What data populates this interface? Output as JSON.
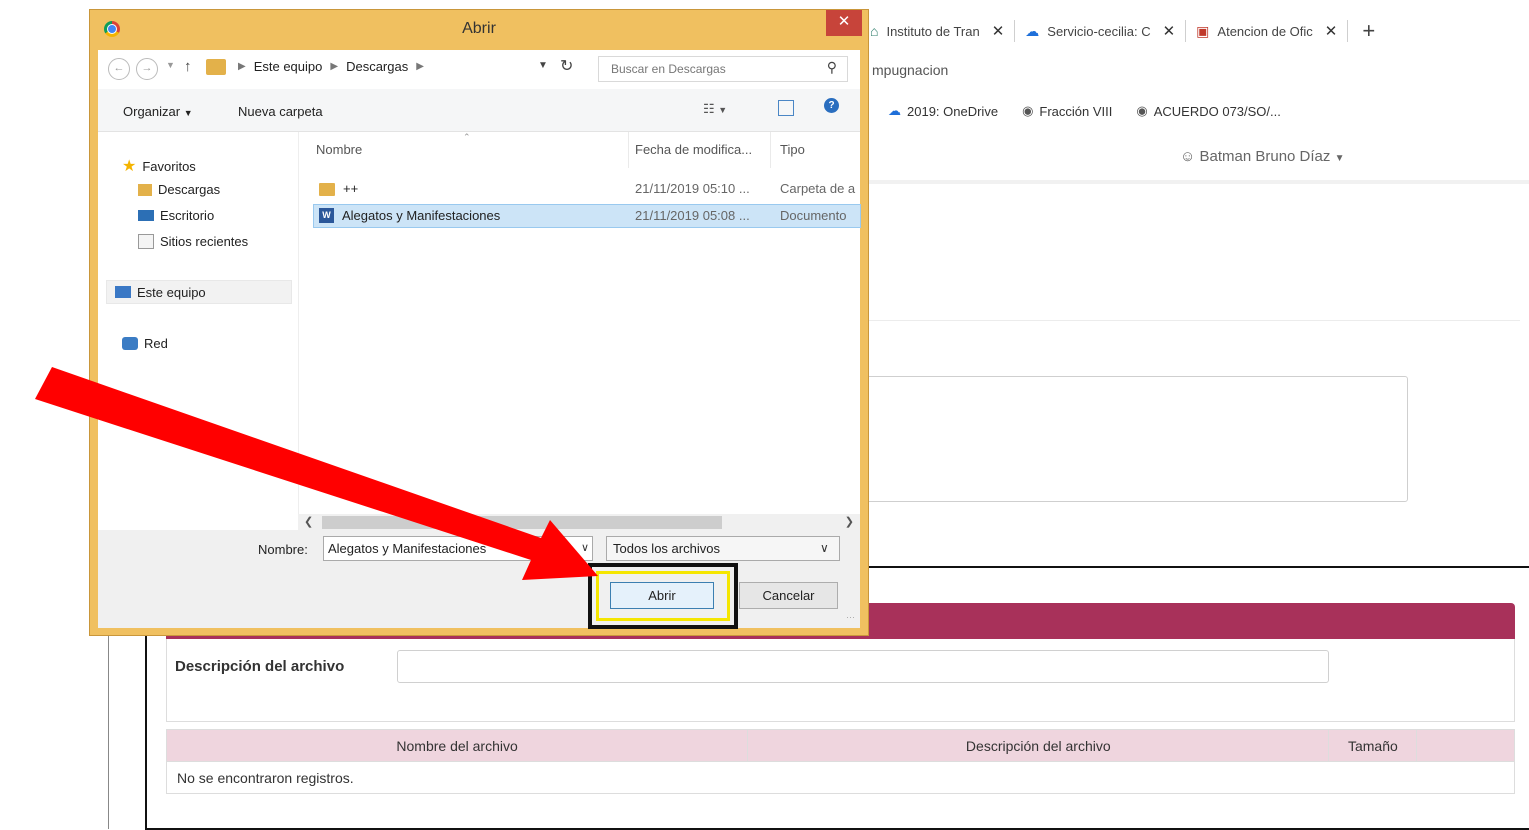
{
  "browser": {
    "tabs": [
      {
        "title": "Instituto de Tran",
        "icon": "house-icon"
      },
      {
        "title": "Servicio-cecilia: C",
        "icon": "cloud-icon"
      },
      {
        "title": "Atencion de Ofic",
        "icon": "app-icon"
      }
    ],
    "address_text": "mpugnacion",
    "bookmarks": [
      "2019: OneDrive",
      "Fracción VIII",
      "ACUERDO 073/SO/..."
    ],
    "user": "Batman Bruno Díaz"
  },
  "page": {
    "description_label": "Descripción del archivo",
    "table": {
      "columns": [
        "Nombre del archivo",
        "Descripción del archivo",
        "Tamaño"
      ],
      "empty_message": "No se encontraron registros."
    }
  },
  "dialog": {
    "title": "Abrir",
    "breadcrumb": [
      "Este equipo",
      "Descargas"
    ],
    "search_placeholder": "Buscar en Descargas",
    "toolbar": {
      "organize": "Organizar",
      "new_folder": "Nueva carpeta"
    },
    "nav": {
      "favorites": "Favoritos",
      "downloads": "Descargas",
      "desktop": "Escritorio",
      "recent": "Sitios recientes",
      "this_pc": "Este equipo",
      "network": "Red"
    },
    "columns": {
      "name": "Nombre",
      "date": "Fecha de modifica...",
      "type": "Tipo"
    },
    "files": [
      {
        "name": "++",
        "date": "21/11/2019 05:10 ...",
        "type": "Carpeta de a",
        "icon": "folder-icon"
      },
      {
        "name": "Alegatos y Manifestaciones",
        "date": "21/11/2019 05:08 ...",
        "type": "Documento",
        "icon": "word-document-icon"
      }
    ],
    "filename_label": "Nombre:",
    "filename_value": "Alegatos y Manifestaciones",
    "filter_value": "Todos los archivos",
    "open_button": "Abrir",
    "cancel_button": "Cancelar"
  },
  "colors": {
    "accent_maroon": "#a8315a",
    "annotation_arrow": "#ff0000",
    "highlight_yellow": "#f5e600",
    "dialog_frame": "#f0c060"
  }
}
